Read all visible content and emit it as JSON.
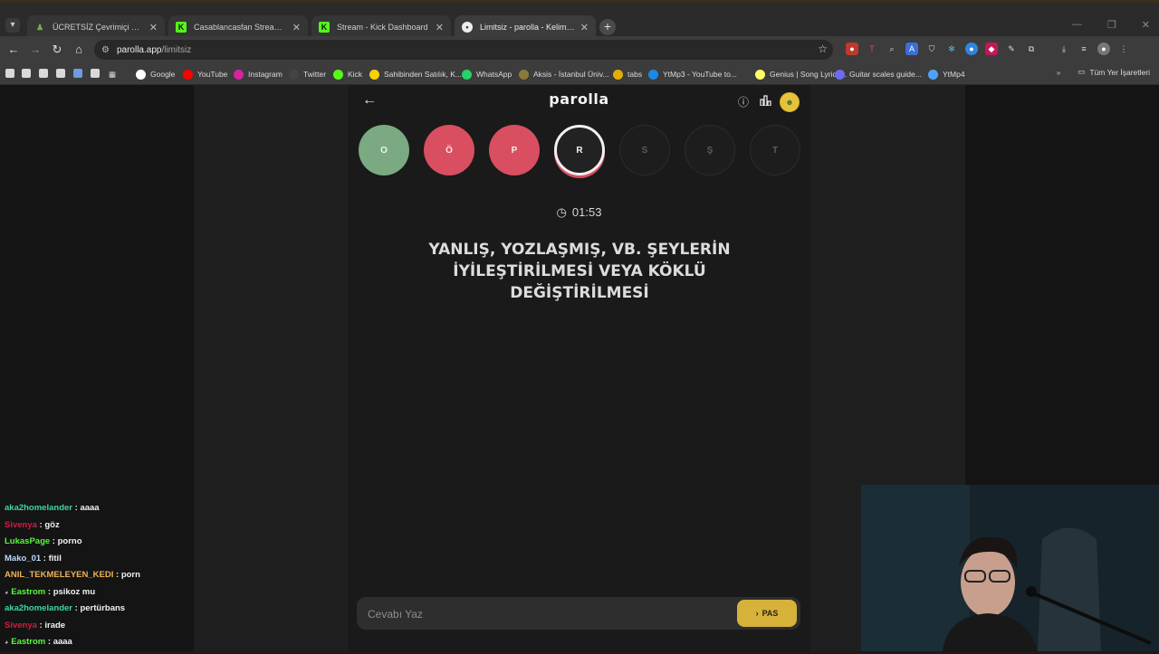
{
  "browser": {
    "tabs": [
      {
        "title": "ÜCRETSİZ Çevrimiçi Satranç Oy...",
        "close": "✕",
        "favicon": "chess-pawn-icon",
        "active": false
      },
      {
        "title": "Casablancasfan Stream - Watch...",
        "close": "✕",
        "favicon": "kick-icon",
        "active": false
      },
      {
        "title": "Stream - Kick Dashboard",
        "close": "✕",
        "favicon": "kick-icon",
        "active": false
      },
      {
        "title": "Limitsiz - parolla - Kelime oyun...",
        "close": "✕",
        "favicon": "parolla-icon",
        "active": true
      }
    ],
    "url_host": "parolla.app",
    "url_path": "/limitsiz",
    "bookmarks": [
      {
        "label": "Google",
        "color": "#ffffff"
      },
      {
        "label": "YouTube",
        "color": "#ff0000"
      },
      {
        "label": "Instagram",
        "color": "#d6249f"
      },
      {
        "label": "Twitter",
        "color": "#444444"
      },
      {
        "label": "Kick",
        "color": "#53fc18"
      },
      {
        "label": "Sahibinden Satılık, K...",
        "color": "#f7d200"
      },
      {
        "label": "WhatsApp",
        "color": "#25d366"
      },
      {
        "label": "Aksis - İstanbul Üniv...",
        "color": "#8a7a3a"
      },
      {
        "label": "tabs",
        "color": "#e0b000"
      },
      {
        "label": "YtMp3 - YouTube to...",
        "color": "#1e88e5"
      },
      {
        "label": "Genius | Song Lyrics...",
        "color": "#ffff64"
      },
      {
        "label": "Guitar scales guide...",
        "color": "#6c6cf0"
      },
      {
        "label": "YtMp4",
        "color": "#4fa3ff"
      }
    ],
    "all_bookmarks": "Tüm Yer İşaretleri"
  },
  "app": {
    "logo": "parolla",
    "letters": [
      {
        "char": "O",
        "state": "correct"
      },
      {
        "char": "Ö",
        "state": "wrong"
      },
      {
        "char": "P",
        "state": "wrong"
      },
      {
        "char": "R",
        "state": "current"
      },
      {
        "char": "S",
        "state": "pending"
      },
      {
        "char": "Ş",
        "state": "pending"
      },
      {
        "char": "T",
        "state": "pending"
      }
    ],
    "timer": "01:53",
    "question": "YANLIŞ, YOZLAŞMIŞ, VB. ŞEYLERİN İYİLEŞTİRİLMESİ VEYA KÖKLÜ DEĞİŞTİRİLMESİ",
    "answer_placeholder": "Cevabı Yaz",
    "pass_label": "PAS",
    "colors": {
      "correct": "#7aa982",
      "wrong": "#d94e60",
      "pass": "#d7b23a"
    }
  },
  "chat": [
    {
      "user": "aka2homelander",
      "msg": "aaaa",
      "color": "#3fd7a0",
      "badge": false
    },
    {
      "user": "Sivenya",
      "msg": "göz",
      "color": "#d11d3f",
      "badge": false
    },
    {
      "user": "LukasPage",
      "msg": "porno",
      "color": "#57f83c",
      "badge": false
    },
    {
      "user": "Mako_01",
      "msg": "fitil",
      "color": "#bcd7ff",
      "badge": false
    },
    {
      "user": "ANIL_TEKMELEYEN_KEDI",
      "msg": "porn",
      "color": "#f0b35a",
      "badge": false
    },
    {
      "user": "Eastrom",
      "msg": "psikoz mu",
      "color": "#57f83c",
      "badge": true
    },
    {
      "user": "aka2homelander",
      "msg": "pertürbans",
      "color": "#3fd7a0",
      "badge": false
    },
    {
      "user": "Sivenya",
      "msg": "irade",
      "color": "#d11d3f",
      "badge": false
    },
    {
      "user": "Eastrom",
      "msg": "aaaa",
      "color": "#57f83c",
      "badge": true
    }
  ]
}
